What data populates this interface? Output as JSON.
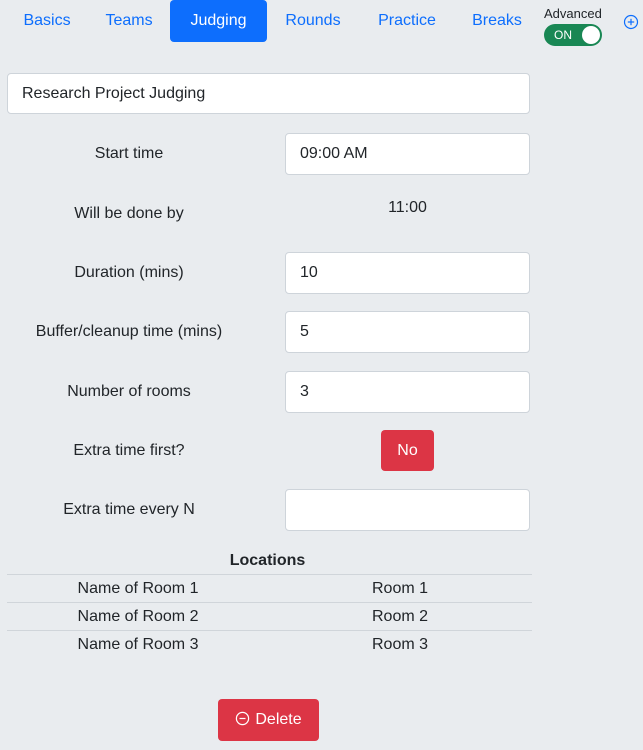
{
  "tabs": [
    {
      "label": "Basics",
      "active": false
    },
    {
      "label": "Teams",
      "active": false
    },
    {
      "label": "Judging",
      "active": true
    },
    {
      "label": "Rounds",
      "active": false
    },
    {
      "label": "Practice",
      "active": false
    },
    {
      "label": "Breaks",
      "active": false
    }
  ],
  "advanced": {
    "label": "Advanced",
    "toggle_text": "ON"
  },
  "add_icon": "plus-circle-icon",
  "session": {
    "title_value": "Research Project Judging"
  },
  "fields": {
    "start_time": {
      "label": "Start time",
      "value": "09:00 AM"
    },
    "done_by": {
      "label": "Will be done by",
      "value": "11:00"
    },
    "duration": {
      "label": "Duration (mins)",
      "value": "10"
    },
    "buffer": {
      "label": "Buffer/cleanup time (mins)",
      "value": "5"
    },
    "rooms": {
      "label": "Number of rooms",
      "value": "3"
    },
    "extra_first": {
      "label": "Extra time first?",
      "button_label": "No"
    },
    "extra_every": {
      "label": "Extra time every N",
      "value": ""
    }
  },
  "locations": {
    "heading": "Locations",
    "rows": [
      {
        "name_label": "Name of Room 1",
        "value": "Room 1"
      },
      {
        "name_label": "Name of Room 2",
        "value": "Room 2"
      },
      {
        "name_label": "Name of Room 3",
        "value": "Room 3"
      }
    ]
  },
  "delete_button": {
    "label": "Delete",
    "icon": "minus-circle-icon"
  },
  "colors": {
    "primary": "#0d6efd",
    "danger": "#dc3545",
    "success": "#198754",
    "background": "#e9ecef"
  }
}
